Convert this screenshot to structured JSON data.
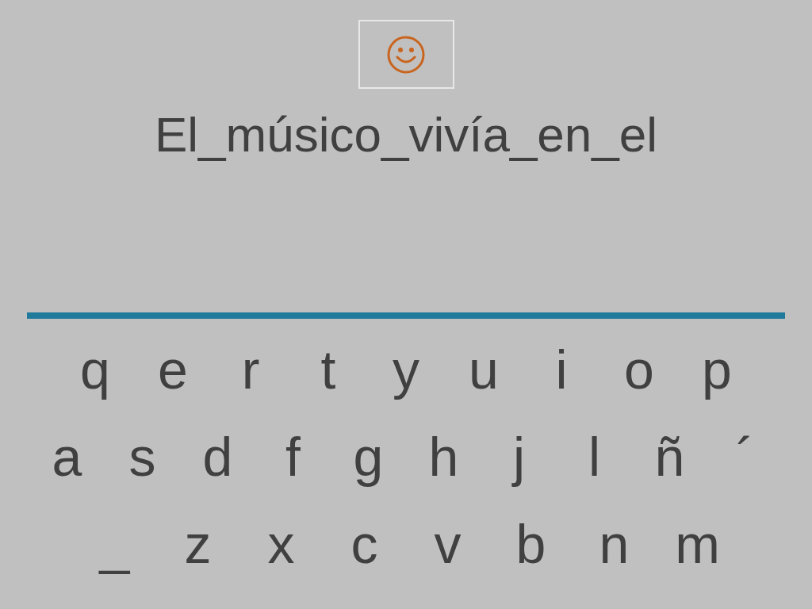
{
  "sentence": "El_músico_vivía_en_el",
  "keyboard": {
    "rows": [
      [
        "q",
        "e",
        "r",
        "t",
        "y",
        "u",
        "i",
        "o",
        "p"
      ],
      [
        "a",
        "s",
        "d",
        "f",
        "g",
        "h",
        "j",
        "l",
        "ñ",
        "´"
      ],
      [
        "_",
        "z",
        "x",
        "c",
        "v",
        "b",
        "n",
        "m"
      ]
    ]
  }
}
